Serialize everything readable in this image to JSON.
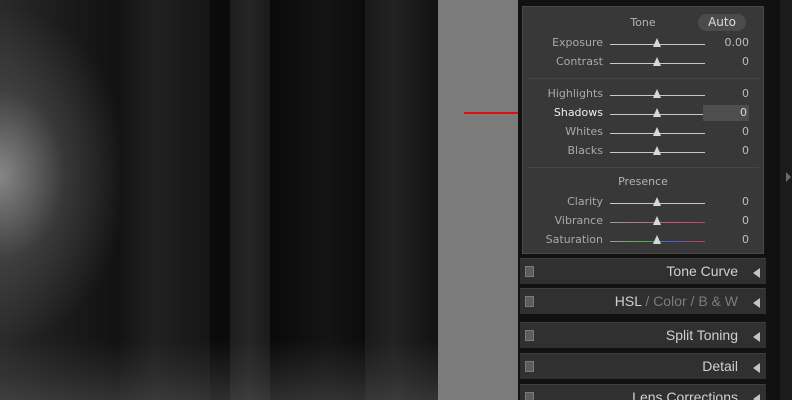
{
  "basic_panel": {
    "tone_header": "Tone",
    "auto_label": "Auto",
    "presence_header": "Presence",
    "tone_sliders": [
      {
        "label": "Exposure",
        "value": "0.00"
      },
      {
        "label": "Contrast",
        "value": "0"
      }
    ],
    "tone_adjust_sliders": [
      {
        "label": "Highlights",
        "value": "0"
      },
      {
        "label": "Shadows",
        "value": "0"
      },
      {
        "label": "Whites",
        "value": "0"
      },
      {
        "label": "Blacks",
        "value": "0"
      }
    ],
    "presence_sliders": [
      {
        "label": "Clarity",
        "value": "0"
      },
      {
        "label": "Vibrance",
        "value": "0"
      },
      {
        "label": "Saturation",
        "value": "0"
      }
    ]
  },
  "sections": {
    "tone_curve": "Tone Curve",
    "hsl": "HSL",
    "hsl_sep1": "/",
    "color": "Color",
    "hsl_sep2": "/",
    "bw": "B & W",
    "split_toning": "Split Toning",
    "detail": "Detail",
    "lens_corrections": "Lens Corrections"
  },
  "colors": {
    "annotation_arrow": "#e01010",
    "panel_bg": "#383838"
  }
}
